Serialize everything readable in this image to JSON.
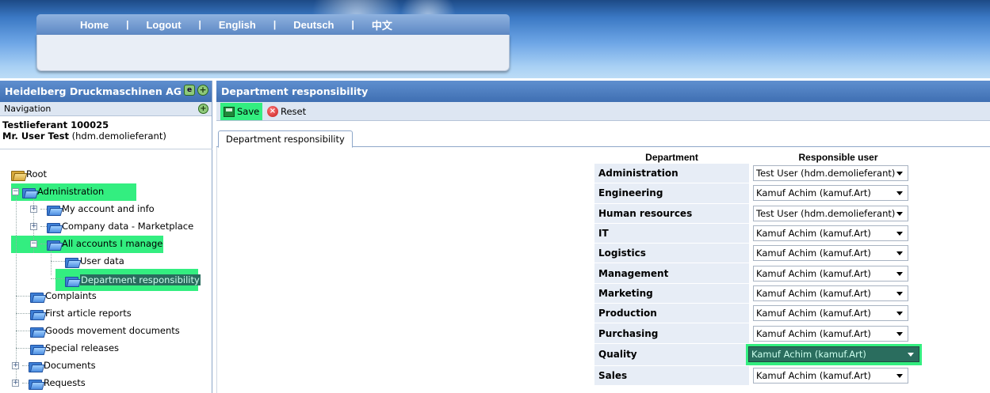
{
  "topnav": {
    "home": "Home",
    "logout": "Logout",
    "english": "English",
    "deutsch": "Deutsch",
    "chinese": "中文",
    "sep": "|"
  },
  "left": {
    "company": "Heidelberg Druckmaschinen AG",
    "navigation_label": "Navigation",
    "user_line1": "Testlieferant 100025",
    "user_name": "Mr. User Test",
    "user_login": "(hdm.demolieferant)",
    "tree": {
      "root": "Root",
      "administration": "Administration",
      "my_account": "My account and info",
      "company_data": "Company data - Marketplace",
      "all_accounts": "All accounts I manage",
      "user_data": "User data",
      "dept_resp": "Department responsibility",
      "complaints": "Complaints",
      "first_article": "First article reports",
      "goods_movement": "Goods movement documents",
      "special_releases": "Special releases",
      "documents": "Documents",
      "requests": "Requests"
    }
  },
  "right": {
    "title": "Department responsibility",
    "save_label": "Save",
    "reset_label": "Reset",
    "tab_label": "Department responsibility",
    "col_department": "Department",
    "col_user": "Responsible user",
    "rows": [
      {
        "dept": "Administration",
        "user": "Test User (hdm.demolieferant)"
      },
      {
        "dept": "Engineering",
        "user": "Kamuf Achim (kamuf.Art)"
      },
      {
        "dept": "Human resources",
        "user": "Test User (hdm.demolieferant)"
      },
      {
        "dept": "IT",
        "user": "Kamuf Achim (kamuf.Art)"
      },
      {
        "dept": "Logistics",
        "user": "Kamuf Achim (kamuf.Art)"
      },
      {
        "dept": "Management",
        "user": "Kamuf Achim (kamuf.Art)"
      },
      {
        "dept": "Marketing",
        "user": "Kamuf Achim (kamuf.Art)"
      },
      {
        "dept": "Production",
        "user": "Kamuf Achim (kamuf.Art)"
      },
      {
        "dept": "Purchasing",
        "user": "Kamuf Achim (kamuf.Art)"
      },
      {
        "dept": "Quality",
        "user": "Kamuf Achim (kamuf.Art)"
      },
      {
        "dept": "Sales",
        "user": "Kamuf Achim (kamuf.Art)"
      }
    ]
  },
  "colors": {
    "highlight": "#33ee80",
    "header_blue": "#3f6fb2",
    "selected_item": "#2a6d5e"
  }
}
